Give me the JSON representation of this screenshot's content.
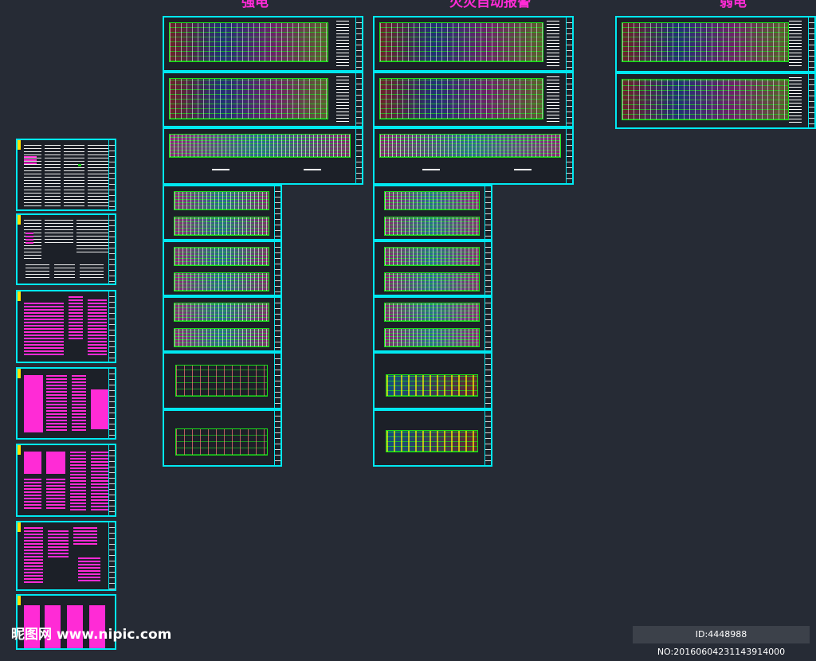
{
  "headers": {
    "strong": "强电",
    "fire": "火灾自动报警",
    "weak": "弱电"
  },
  "watermark": "昵图网 www.nipic.com",
  "image_id": "ID:4448988 NO:20160604231143914000",
  "colors": {
    "background": "#262b35",
    "frame": "#00e8f0",
    "header": "#ff2bd6",
    "plan_lines": "#18e018",
    "accent_yellow": "#ffe000"
  }
}
